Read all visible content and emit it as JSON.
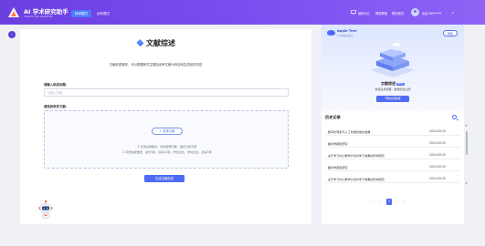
{
  "header": {
    "logo_title": "AI 学术研究助手",
    "logo_subtitle": "Chat for the academia",
    "tabs": [
      {
        "label": "科研模式",
        "active": true
      },
      {
        "label": "创作模式",
        "active": false
      }
    ],
    "links": [
      "使用中心",
      "帮助教程",
      "联系我们"
    ],
    "user_name": "欢迎 MH*****",
    "accent_color": "#6a3fe0"
  },
  "main": {
    "title": "文献综述",
    "description": "文献综述服务，可以根据研究主题及参考文献为你自动生成综述内容",
    "topic_label": "请输入综述标题:",
    "topic_placeholder": "请输入标题",
    "topic_value": "",
    "upload_label": "请选择参考文献:",
    "upload_button": "+ 选择文献",
    "upload_hint_1": "1.可选文献格式：支持搜索引擎，格式识别可限",
    "upload_hint_2": "2.可选文献数量：最长5篇，最多10篇，学位论文，学位论文，最多5篇",
    "generate_button": "生成文献综述"
  },
  "side": {
    "brand_name": "Apple Tree",
    "brand_subtitle": "AI 学术研究助手",
    "help_button": "帮助",
    "feature_title": "文献综述",
    "feature_badge": "BETA",
    "feature_desc": "快速生成摘要，数据综合主题",
    "guide_button": "开始使用教程"
  },
  "history": {
    "title": "历史记录",
    "items": [
      {
        "title": "数字化转型与人工智能的融合发展",
        "date": "2024-09-25"
      },
      {
        "title": "脑科学模型研究",
        "date": "2024-09-25"
      },
      {
        "title": "关于学习中心教学方法对学习效果的影响研究",
        "date": "2024-09-25"
      },
      {
        "title": "脑科学模型研究",
        "date": "2024-09-25"
      },
      {
        "title": "关于学习中心教学方法对学习效果的影响研究",
        "date": "2024-09-25"
      }
    ],
    "pagination": {
      "current": "1",
      "prev": "‹",
      "next": "›"
    }
  },
  "icons": {
    "logo": "academic-triangle-icon",
    "collapse": "chevron-left-icon",
    "search": "search-icon",
    "user": "user-avatar-icon"
  }
}
